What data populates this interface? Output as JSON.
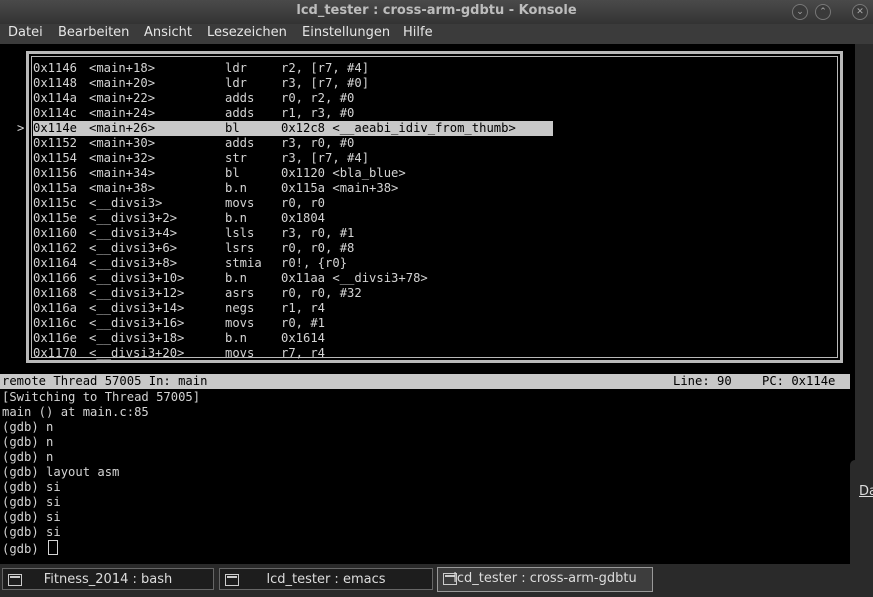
{
  "window": {
    "title": "lcd_tester : cross-arm-gdbtu - Konsole"
  },
  "menu": [
    "Datei",
    "Bearbeiten",
    "Ansicht",
    "Lesezeichen",
    "Einstellungen",
    "Hilfe"
  ],
  "asm": {
    "rows": [
      {
        "addr": "0x1146",
        "sym": "<main+18>",
        "op": "ldr",
        "args": "r2, [r7, #4]"
      },
      {
        "addr": "0x1148",
        "sym": "<main+20>",
        "op": "ldr",
        "args": "r3, [r7, #0]"
      },
      {
        "addr": "0x114a",
        "sym": "<main+22>",
        "op": "adds",
        "args": "r0, r2, #0"
      },
      {
        "addr": "0x114c",
        "sym": "<main+24>",
        "op": "adds",
        "args": "r1, r3, #0"
      },
      {
        "addr": "0x114e",
        "sym": "<main+26>",
        "op": "bl",
        "args": "0x12c8 <__aeabi_idiv_from_thumb>"
      },
      {
        "addr": "0x1152",
        "sym": "<main+30>",
        "op": "adds",
        "args": "r3, r0, #0"
      },
      {
        "addr": "0x1154",
        "sym": "<main+32>",
        "op": "str",
        "args": "r3, [r7, #4]"
      },
      {
        "addr": "0x1156",
        "sym": "<main+34>",
        "op": "bl",
        "args": "0x1120 <bla_blue>"
      },
      {
        "addr": "0x115a",
        "sym": "<main+38>",
        "op": "b.n",
        "args": "0x115a <main+38>"
      },
      {
        "addr": "0x115c",
        "sym": "<__divsi3>",
        "op": "movs",
        "args": "r0, r0"
      },
      {
        "addr": "0x115e",
        "sym": "<__divsi3+2>",
        "op": "b.n",
        "args": "0x1804"
      },
      {
        "addr": "0x1160",
        "sym": "<__divsi3+4>",
        "op": "lsls",
        "args": "r3, r0, #1"
      },
      {
        "addr": "0x1162",
        "sym": "<__divsi3+6>",
        "op": "lsrs",
        "args": "r0, r0, #8"
      },
      {
        "addr": "0x1164",
        "sym": "<__divsi3+8>",
        "op": "stmia",
        "args": "r0!, {r0}"
      },
      {
        "addr": "0x1166",
        "sym": "<__divsi3+10>",
        "op": "b.n",
        "args": "0x11aa <__divsi3+78>"
      },
      {
        "addr": "0x1168",
        "sym": "<__divsi3+12>",
        "op": "asrs",
        "args": "r0, r0, #32"
      },
      {
        "addr": "0x116a",
        "sym": "<__divsi3+14>",
        "op": "negs",
        "args": "r1, r4"
      },
      {
        "addr": "0x116c",
        "sym": "<__divsi3+16>",
        "op": "movs",
        "args": "r0, #1"
      },
      {
        "addr": "0x116e",
        "sym": "<__divsi3+18>",
        "op": "b.n",
        "args": "0x1614"
      },
      {
        "addr": "0x1170",
        "sym": "<__divsi3+20>",
        "op": "movs",
        "args": "r7, r4"
      }
    ],
    "marker": ">"
  },
  "status": {
    "left": "remote Thread 57005 In: main",
    "line": "Line: 90",
    "pc": "PC: 0x114e"
  },
  "console": [
    "[Switching to Thread 57005]",
    "main () at main.c:85",
    "(gdb) n",
    "(gdb) n",
    "(gdb) n",
    "(gdb) layout asm",
    "(gdb) si",
    "(gdb) si",
    "(gdb) si",
    "(gdb) si",
    "(gdb) "
  ],
  "popup_text": "Da",
  "tabs": [
    {
      "label": "Fitness_2014 : bash"
    },
    {
      "label": "lcd_tester : emacs"
    },
    {
      "label": "lcd_tester : cross-arm-gdbtu"
    }
  ]
}
